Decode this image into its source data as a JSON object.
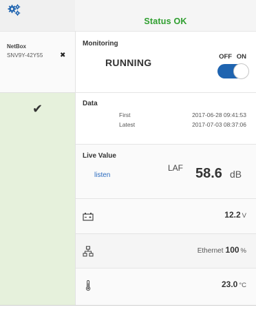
{
  "header": {
    "status_text": "Status OK",
    "status_color": "#2e9e2e",
    "settings_icon": "gears-icon"
  },
  "device": {
    "title": "NetBox",
    "serial": "SNV9Y-42Y55",
    "remove_symbol": "✖",
    "state_symbol": "✔"
  },
  "monitoring": {
    "title": "Monitoring",
    "state": "RUNNING",
    "toggle_off_label": "OFF",
    "toggle_on_label": "ON",
    "toggle_on": true,
    "toggle_color": "#1f64b0"
  },
  "data": {
    "title": "Data",
    "first_label": "First",
    "first_value": "2017-06-28 09:41:53",
    "latest_label": "Latest",
    "latest_value": "2017-07-03 08:37:06"
  },
  "live": {
    "title": "Live Value",
    "listen_label": "listen",
    "metric": "LAF",
    "value": "58.6",
    "unit": "dB"
  },
  "battery": {
    "icon": "battery-icon",
    "value": "12.2",
    "unit": "V"
  },
  "network": {
    "icon": "network-icon",
    "label": "Ethernet",
    "value": "100",
    "unit": "%"
  },
  "temperature": {
    "icon": "thermometer-icon",
    "value": "23.0",
    "unit": "°C"
  }
}
